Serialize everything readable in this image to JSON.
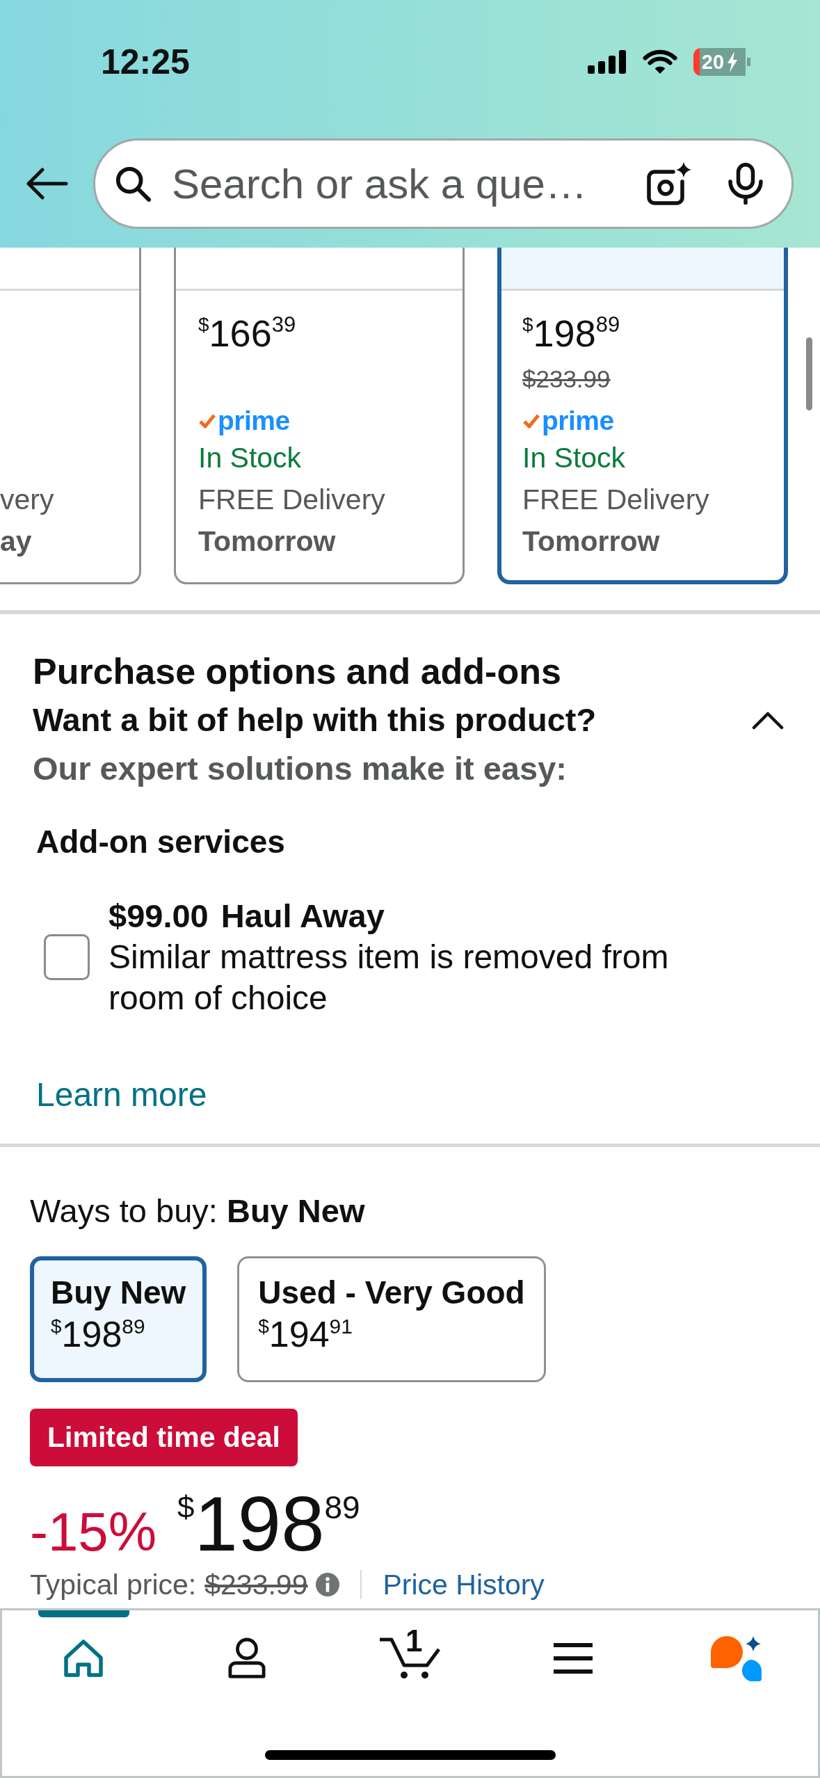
{
  "status_bar": {
    "time": "12:25",
    "battery": "20"
  },
  "search_bar": {
    "placeholder": "Search or ask a que…"
  },
  "size_options": [
    {
      "selected": false,
      "delivery": "very",
      "delivery_day": "ay"
    },
    {
      "selected": false,
      "price": {
        "currency": "$",
        "whole": "166",
        "fraction": "39"
      },
      "prime_badge": "prime",
      "stock": "In Stock",
      "delivery": "FREE Delivery",
      "delivery_day": "Tomorrow"
    },
    {
      "selected": true,
      "price": {
        "currency": "$",
        "whole": "198",
        "fraction": "89"
      },
      "list_price": "$233.99",
      "prime_badge": "prime",
      "stock": "In Stock",
      "delivery": "FREE Delivery",
      "delivery_day": "Tomorrow"
    }
  ],
  "purchase_options": {
    "title": "Purchase options and add-ons",
    "subtitle": "Want a bit of help with this product?",
    "note": "Our expert solutions make it easy:",
    "expanded": true,
    "addons_title": "Add-on services",
    "addons": [
      {
        "checked": false,
        "price": "$99.00",
        "name": "Haul Away",
        "description": "Similar mattress item is removed from room of choice"
      }
    ],
    "link": "Learn more"
  },
  "ways_to_buy": {
    "label": "Ways to buy: **Buy New**",
    "options": [
      {
        "selected": true,
        "name": "Buy New",
        "price": {
          "currency": "$",
          "whole": "198",
          "fraction": "89"
        }
      },
      {
        "selected": false,
        "name": "Used - Very Good",
        "price": {
          "currency": "$",
          "whole": "194",
          "fraction": "91"
        }
      }
    ],
    "deal_badge": "Limited time deal",
    "discount": "-15%",
    "price": {
      "currency": "$",
      "whole": "198",
      "fraction": "89"
    },
    "typical_price_label": "Typical price:",
    "typical_price": "$233.99",
    "price_history_link": "Price History"
  },
  "bottom_nav": [
    {
      "kind": "home",
      "selected": true
    },
    {
      "kind": "account",
      "selected": false
    },
    {
      "kind": "cart",
      "selected": false,
      "count": "1"
    },
    {
      "kind": "menu",
      "selected": false
    },
    {
      "kind": "assistant",
      "selected": false
    }
  ]
}
